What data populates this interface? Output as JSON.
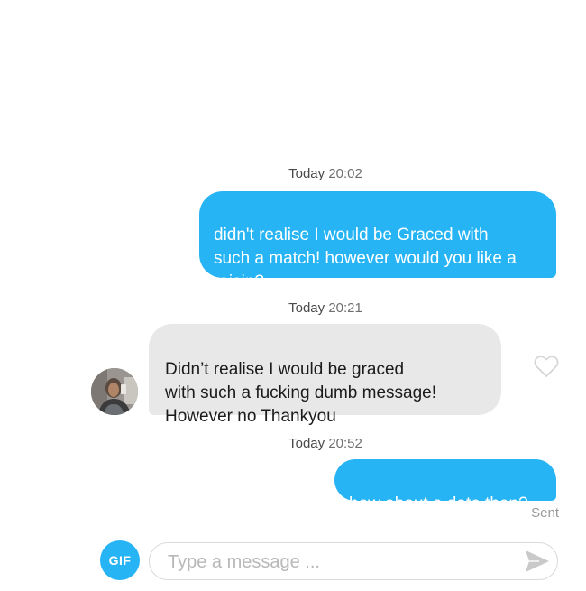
{
  "conversation": {
    "messages": [
      {
        "timestamp_day": "Today",
        "timestamp_time": "20:02",
        "direction": "sent",
        "text": "didn't realise I would be Graced with\nsuch a match! however would you like a\nraisin?"
      },
      {
        "timestamp_day": "Today",
        "timestamp_time": "20:21",
        "direction": "received",
        "text": "Didn’t realise I would be graced\nwith such a fucking dumb message!\nHowever no Thankyou"
      },
      {
        "timestamp_day": "Today",
        "timestamp_time": "20:52",
        "direction": "sent",
        "text": "how about a date then?"
      }
    ],
    "status_label": "Sent"
  },
  "composer": {
    "gif_label": "GIF",
    "placeholder": "Type a message ..."
  },
  "icons": {
    "like": "heart-outline-icon",
    "send": "paper-plane-send-icon"
  },
  "colors": {
    "accent": "#26b4f4",
    "received_bubble": "#e8e8e8",
    "timestamp": "#6f6f6f"
  }
}
